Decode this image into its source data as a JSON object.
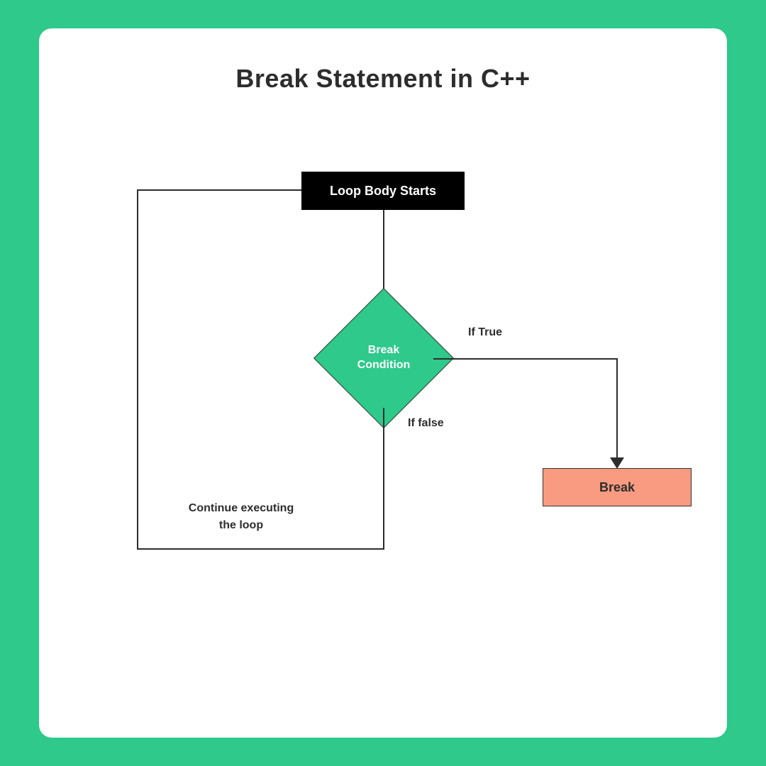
{
  "title": "Break Statement in C++",
  "nodes": {
    "start": "Loop Body Starts",
    "condition_line1": "Break",
    "condition_line2": "Condition",
    "break": "Break"
  },
  "labels": {
    "true": "If  True",
    "false": "If false",
    "continue_line1": "Continue executing",
    "continue_line2": "the loop"
  },
  "colors": {
    "background": "#2ec98b",
    "card": "#ffffff",
    "start_node": "#000000",
    "diamond": "#2ec98b",
    "break_node": "#f89b80",
    "text_dark": "#2d2d2d"
  }
}
